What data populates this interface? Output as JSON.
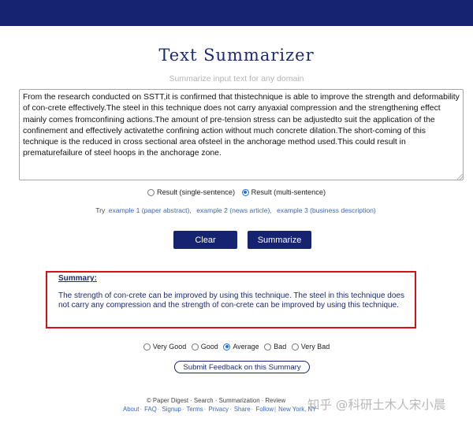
{
  "header": {
    "bar_color": "#152371"
  },
  "app": {
    "title": "Text Summarizer",
    "subtitle": "Summarize input text for any domain"
  },
  "input": {
    "value": "From the research conducted on SSTT,it is confirmed that thistechnique is able to improve the strength and deformability of con-crete effectively.The steel in this technique does not carry anyaxial compression and the strengthening effect mainly comes fromconfining actions.The amount of pre-tension stress can be adjustedto suit the application of the confinement and effectively activatethe confining action without much concrete dilation.The short-coming of this technique is the reduced in cross sectional area ofsteel in the anchorage method used.This could result in prematurefailure of steel hoops in the anchorage zone."
  },
  "mode": {
    "options": [
      "Result (single-sentence)",
      "Result (multi-sentence)"
    ],
    "selected": "Result (multi-sentence)"
  },
  "examples": {
    "prefix": "Try",
    "links": [
      "example 1 (paper abstract),",
      "example 2 (news article),",
      "example 3 (business description)"
    ]
  },
  "buttons": {
    "clear": "Clear",
    "summarize": "Summarize"
  },
  "summary": {
    "heading": "Summary:",
    "text": "The strength of con-crete can be improved by using this technique. The steel in this technique does not carry any compression and the strength of con-crete can be improved by using this technique.",
    "highlight_color": "#d4111b"
  },
  "rating": {
    "options": [
      "Very Good",
      "Good",
      "Average",
      "Bad",
      "Very Bad"
    ],
    "selected": "Average"
  },
  "feedback": {
    "button": "Submit Feedback on this Summary"
  },
  "footer": {
    "line1": [
      "© Paper Digest",
      "Search",
      "Summarization",
      "Review"
    ],
    "line2": [
      "About",
      "FAQ",
      "Signup",
      "Terms",
      "Privacy",
      "Share",
      "Follow",
      "New York, NY"
    ]
  },
  "watermark": {
    "text": "知乎 @科研土木人宋小晨"
  }
}
